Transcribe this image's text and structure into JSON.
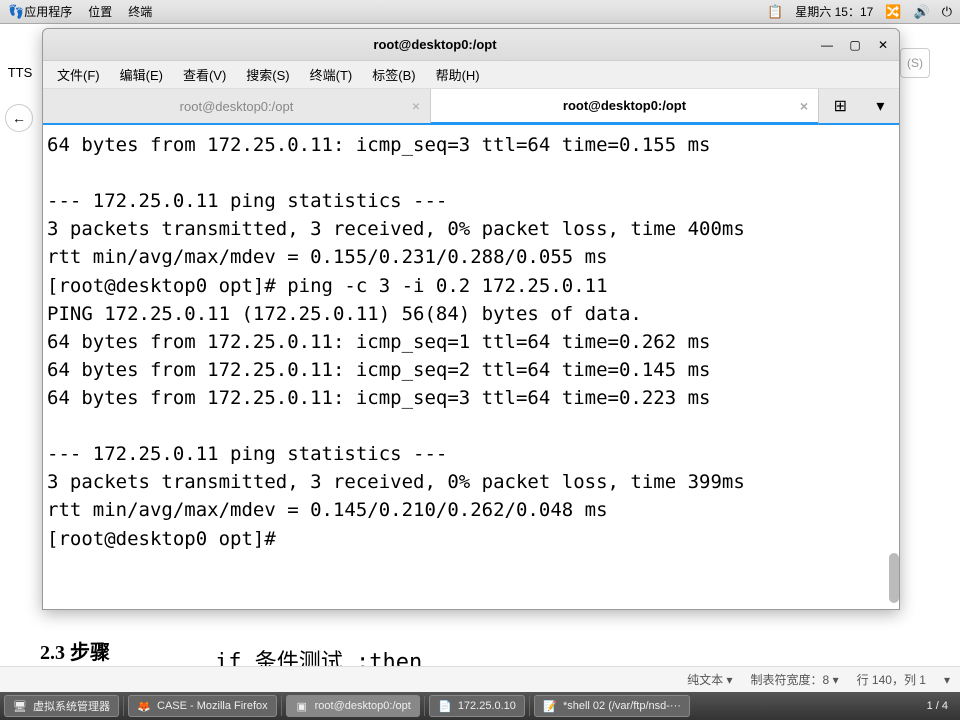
{
  "top_panel": {
    "apps": "应用程序",
    "places": "位置",
    "terminal": "终端",
    "datetime": "星期六 15：17",
    "input_icon": "zh"
  },
  "background": {
    "back_icon": "←",
    "tts": "TTS",
    "s_btn": "(S)",
    "section_title": "2.3 步骤",
    "code_line": "if 条件测试 ;then",
    "statusbar": {
      "mode": "纯文本",
      "tab_width": "制表符宽度：8",
      "position": "行 140，列 1",
      "dropdown1": "▾",
      "dropdown2": "▾",
      "dropdown3": "▾"
    }
  },
  "terminal": {
    "title": "root@desktop0:/opt",
    "menus": [
      "文件(F)",
      "编辑(E)",
      "查看(V)",
      "搜索(S)",
      "终端(T)",
      "标签(B)",
      "帮助(H)"
    ],
    "tabs": [
      {
        "label": "root@desktop0:/opt",
        "active": false
      },
      {
        "label": "root@desktop0:/opt",
        "active": true
      }
    ],
    "tab_new_icon": "⊞",
    "tab_menu_icon": "▾",
    "tab_close": "×",
    "content": "64 bytes from 172.25.0.11: icmp_seq=3 ttl=64 time=0.155 ms\n\n--- 172.25.0.11 ping statistics ---\n3 packets transmitted, 3 received, 0% packet loss, time 400ms\nrtt min/avg/max/mdev = 0.155/0.231/0.288/0.055 ms\n[root@desktop0 opt]# ping -c 3 -i 0.2 172.25.0.11\nPING 172.25.0.11 (172.25.0.11) 56(84) bytes of data.\n64 bytes from 172.25.0.11: icmp_seq=1 ttl=64 time=0.262 ms\n64 bytes from 172.25.0.11: icmp_seq=2 ttl=64 time=0.145 ms\n64 bytes from 172.25.0.11: icmp_seq=3 ttl=64 time=0.223 ms\n\n--- 172.25.0.11 ping statistics ---\n3 packets transmitted, 3 received, 0% packet loss, time 399ms\nrtt min/avg/max/mdev = 0.145/0.210/0.262/0.048 ms\n[root@desktop0 opt]# "
  },
  "taskbar": {
    "items": [
      {
        "icon": "🖥",
        "label": "虚拟系统管理器"
      },
      {
        "icon": "🦊",
        "label": "CASE - Mozilla Firefox"
      },
      {
        "icon": "▣",
        "label": "root@desktop0:/opt"
      },
      {
        "icon": "📄",
        "label": "172.25.0.10"
      },
      {
        "icon": "📝",
        "label": "*shell 02 (/var/ftp/nsd-···"
      }
    ],
    "pager": "1 / 4"
  }
}
